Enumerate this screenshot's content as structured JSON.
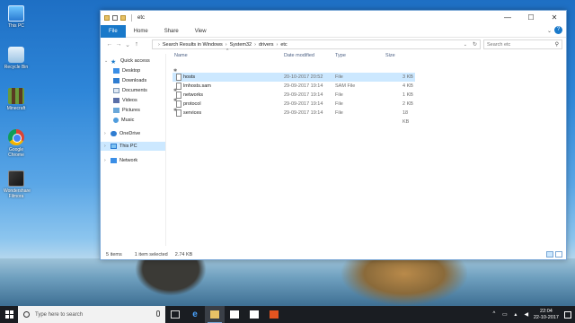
{
  "desktop": {
    "icons": [
      {
        "label": "This PC"
      },
      {
        "label": "Recycle Bin"
      },
      {
        "label": "Minecraft"
      },
      {
        "label": "Google Chrome"
      },
      {
        "label": "Wondershare Filmora"
      }
    ]
  },
  "window": {
    "title": "etc",
    "controls": {
      "minimize": "—",
      "maximize": "☐",
      "close": "✕"
    },
    "ribbon_tabs": [
      "File",
      "Home",
      "Share",
      "View"
    ],
    "expand_glyph": "⌄",
    "help_glyph": "?",
    "nav_glyphs": {
      "back": "←",
      "forward": "→",
      "recent": "⌄",
      "up": "↑"
    },
    "breadcrumb": [
      "Search Results in Windows",
      "System32",
      "drivers",
      "etc"
    ],
    "search_placeholder": "Search etc",
    "search_glyph": "⚲"
  },
  "navpane": {
    "quick_access": "Quick access",
    "items": [
      {
        "label": "Desktop"
      },
      {
        "label": "Downloads"
      },
      {
        "label": "Documents"
      },
      {
        "label": "Videos"
      },
      {
        "label": "Pictures"
      },
      {
        "label": "Music"
      }
    ],
    "onedrive": "OneDrive",
    "this_pc": "This PC",
    "network": "Network"
  },
  "filelist": {
    "columns": [
      "Name",
      "Date modified",
      "Type",
      "Size"
    ],
    "rows": [
      {
        "name": "hosts",
        "date": "20-10-2017 20:52",
        "type": "File",
        "size": "3 KB"
      },
      {
        "name": "lmhosts.sam",
        "date": "29-09-2017 19:14",
        "type": "SAM File",
        "size": "4 KB"
      },
      {
        "name": "networks",
        "date": "29-09-2017 19:14",
        "type": "File",
        "size": "1 KB"
      },
      {
        "name": "protocol",
        "date": "29-09-2017 19:14",
        "type": "File",
        "size": "2 KB"
      },
      {
        "name": "services",
        "date": "29-09-2017 19:14",
        "type": "File",
        "size": "18 KB"
      }
    ]
  },
  "status": {
    "items_count": "5 items",
    "selected": "1 item selected",
    "selected_size": "2.74 KB"
  },
  "taskbar": {
    "search_placeholder": "Type here to search",
    "time": "22:04",
    "date": "22-10-2017"
  }
}
